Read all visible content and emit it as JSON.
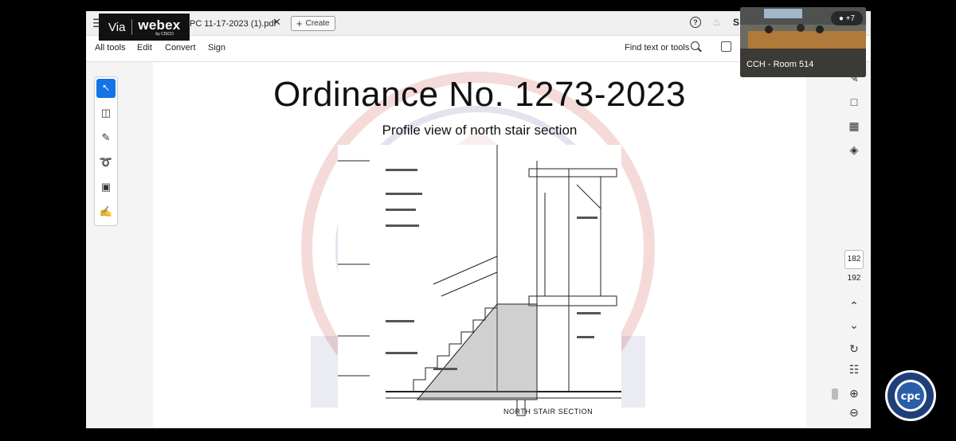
{
  "webex": {
    "via": "Via",
    "brand": "webex",
    "sub": "by CISCO"
  },
  "tab": {
    "doc_title": "PC 11-17-2023 (1).pdf",
    "create_label": "Create"
  },
  "header": {
    "help": "?",
    "avatar": "S"
  },
  "menu": {
    "items": [
      "All tools",
      "Edit",
      "Convert",
      "Sign"
    ],
    "find": "Find text or tools"
  },
  "slide": {
    "title": "Ordinance No. 1273-2023",
    "subtitle": "Profile view of north stair section",
    "caption": "NORTH STAIR SECTION"
  },
  "pages": {
    "current": "182",
    "total": "192"
  },
  "video": {
    "room_label": "CCH - Room 514",
    "participants": "+7"
  },
  "colors": {
    "accent": "#1473e6",
    "watermark_red": "#c0392b",
    "watermark_blue": "#2e3a8c"
  }
}
